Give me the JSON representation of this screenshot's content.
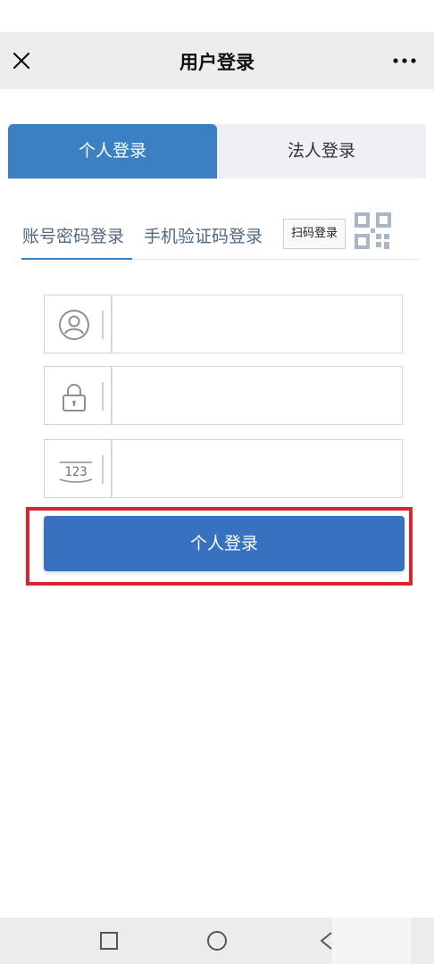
{
  "header": {
    "title": "用户登录",
    "close_icon": "close-icon",
    "more_icon": "more-icon"
  },
  "login_type_tabs": [
    {
      "label": "个人登录",
      "active": true
    },
    {
      "label": "法人登录",
      "active": false
    }
  ],
  "method_tabs": [
    {
      "label": "账号密码登录",
      "active": true
    },
    {
      "label": "手机验证码登录",
      "active": false
    }
  ],
  "qr_login": {
    "label": "扫码登录",
    "icon": "qr-code-icon"
  },
  "form": {
    "fields": [
      {
        "icon": "user-icon",
        "value": "",
        "placeholder": ""
      },
      {
        "icon": "lock-icon",
        "value": "",
        "placeholder": ""
      },
      {
        "icon": "captcha-icon",
        "value": "",
        "placeholder": ""
      }
    ],
    "captcha_icon_text": "123",
    "submit_label": "个人登录"
  },
  "colors": {
    "primary": "#3c80c4",
    "button": "#3871c0",
    "highlight": "#d7262e",
    "method_text": "#4f6785"
  },
  "navbar": {
    "icons": [
      "square-icon",
      "circle-icon",
      "back-triangle-icon"
    ]
  }
}
